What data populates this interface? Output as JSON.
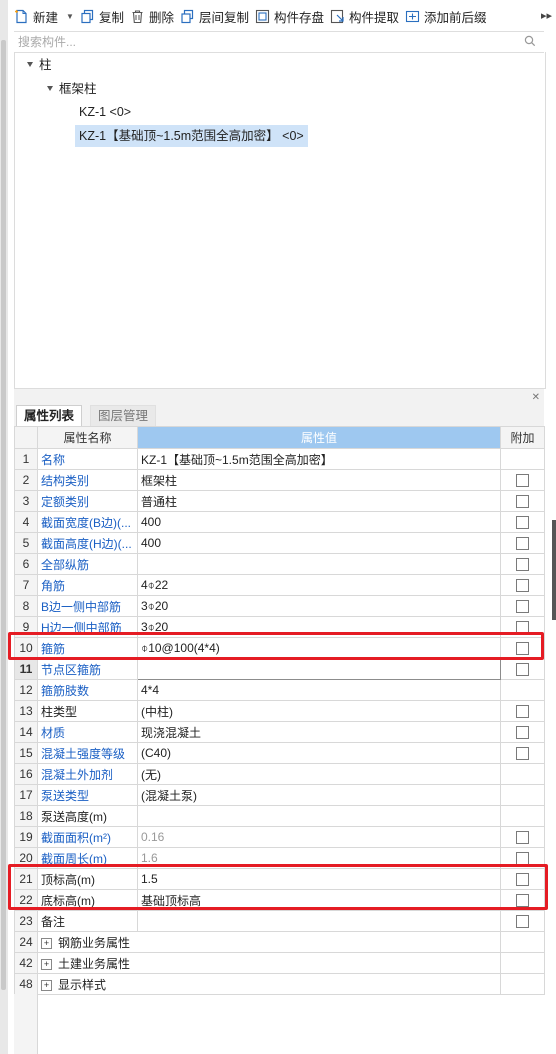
{
  "toolbar": {
    "new_label": "新建",
    "copy_label": "复制",
    "delete_label": "删除",
    "floor_copy_label": "层间复制",
    "save_component_label": "构件存盘",
    "extract_component_label": "构件提取",
    "add_suffix_label": "添加前后缀"
  },
  "search": {
    "placeholder": "搜索构件..."
  },
  "tree": {
    "root": "柱",
    "group": "框架柱",
    "items": [
      "KZ-1 <0>",
      "KZ-1【基础顶~1.5m范围全高加密】 <0>"
    ]
  },
  "panel_tabs": {
    "properties": "属性列表",
    "layers": "图层管理"
  },
  "table": {
    "headers": {
      "name": "属性名称",
      "value": "属性值",
      "extra": "附加"
    },
    "rows": [
      {
        "num": "1",
        "name": "名称",
        "value": "KZ-1【基础顶~1.5m范围全高加密】"
      },
      {
        "num": "2",
        "name": "结构类别",
        "value": "框架柱"
      },
      {
        "num": "3",
        "name": "定额类别",
        "value": "普通柱"
      },
      {
        "num": "4",
        "name": "截面宽度(B边)(...",
        "value": "400"
      },
      {
        "num": "5",
        "name": "截面高度(H边)(...",
        "value": "400"
      },
      {
        "num": "6",
        "name": "全部纵筋",
        "value": ""
      },
      {
        "num": "7",
        "name": "角筋",
        "value": "4⌽22"
      },
      {
        "num": "8",
        "name": "B边一侧中部筋",
        "value": "3⌽20"
      },
      {
        "num": "9",
        "name": "H边一侧中部筋",
        "value": "3⌽20"
      },
      {
        "num": "10",
        "name": "箍筋",
        "value": "⌽10@100(4*4)"
      },
      {
        "num": "11",
        "name": "节点区箍筋",
        "value": ""
      },
      {
        "num": "12",
        "name": "箍筋肢数",
        "value": "4*4"
      },
      {
        "num": "13",
        "name": "柱类型",
        "value": "(中柱)"
      },
      {
        "num": "14",
        "name": "材质",
        "value": "现浇混凝土"
      },
      {
        "num": "15",
        "name": "混凝土强度等级",
        "value": "(C40)"
      },
      {
        "num": "16",
        "name": "混凝土外加剂",
        "value": "(无)"
      },
      {
        "num": "17",
        "name": "泵送类型",
        "value": "(混凝土泵)"
      },
      {
        "num": "18",
        "name": "泵送高度(m)",
        "value": ""
      },
      {
        "num": "19",
        "name": "截面面积(m²)",
        "value": "0.16"
      },
      {
        "num": "20",
        "name": "截面周长(m)",
        "value": "1.6"
      },
      {
        "num": "21",
        "name": "顶标高(m)",
        "value": "1.5"
      },
      {
        "num": "22",
        "name": "底标高(m)",
        "value": "基础顶标高"
      },
      {
        "num": "23",
        "name": "备注",
        "value": ""
      }
    ],
    "groups": [
      {
        "num": "24",
        "name": "钢筋业务属性"
      },
      {
        "num": "42",
        "name": "土建业务属性"
      },
      {
        "num": "48",
        "name": "显示样式"
      }
    ]
  },
  "colors": {
    "highlight": "#e51c24",
    "selected_row": "#cfe3f8",
    "link_blue": "#1a5fc4",
    "header_blue": "#9ec8f0"
  }
}
